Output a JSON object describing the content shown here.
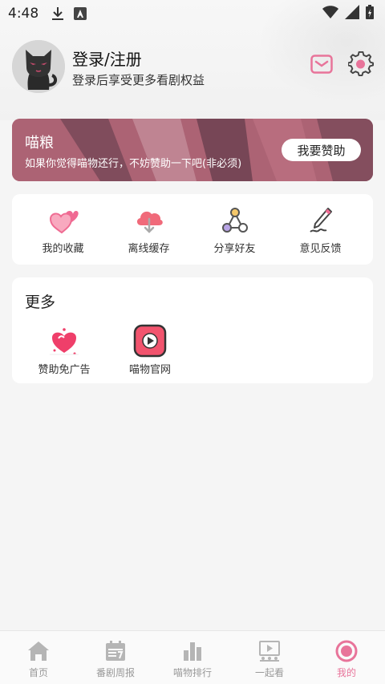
{
  "status_bar": {
    "time": "4:48"
  },
  "profile": {
    "username": "登录/注册",
    "subtitle": "登录后享受更多看剧权益"
  },
  "banner": {
    "title": "喵粮",
    "description": "如果你觉得喵物还行，不妨赞助一下吧(非必须)",
    "button_label": "我要赞助"
  },
  "functions": [
    {
      "label": "我的收藏",
      "icon": "hearts-icon"
    },
    {
      "label": "离线缓存",
      "icon": "cloud-download-icon"
    },
    {
      "label": "分享好友",
      "icon": "share-icon"
    },
    {
      "label": "意见反馈",
      "icon": "pen-feedback-icon"
    }
  ],
  "more": {
    "title": "更多",
    "items": [
      {
        "label": "赞助免广告",
        "icon": "heart-sponsor-icon"
      },
      {
        "label": "喵物官网",
        "icon": "play-website-icon"
      }
    ]
  },
  "tabbar": {
    "tabs": [
      {
        "label": "首页",
        "icon": "home-icon"
      },
      {
        "label": "番剧周报",
        "icon": "calendar-icon"
      },
      {
        "label": "喵物排行",
        "icon": "ranking-icon"
      },
      {
        "label": "一起看",
        "icon": "watch-together-icon"
      },
      {
        "label": "我的",
        "icon": "profile-icon"
      }
    ],
    "active_index": 4
  },
  "colors": {
    "accent": "#e8749a",
    "banner": "#b06676",
    "tab_inactive": "#999999"
  }
}
